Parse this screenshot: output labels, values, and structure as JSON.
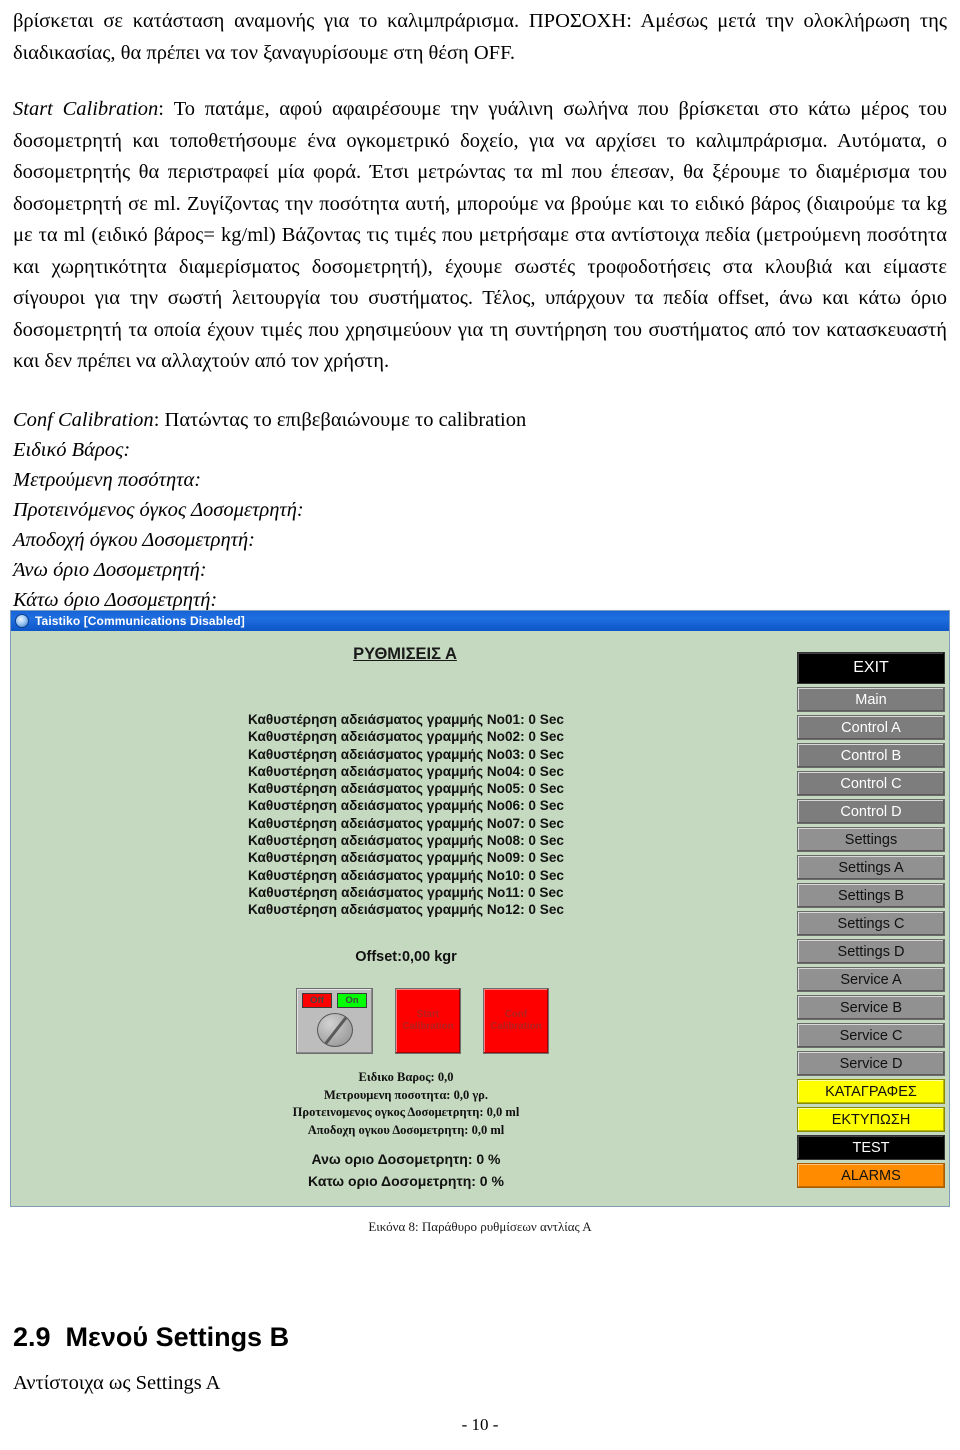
{
  "document": {
    "paragraph_1": "βρίσκεται σε κατάσταση αναμονής για το καλιμπράρισμα. ΠΡΟΣΟΧΗ: Αμέσως μετά την ολοκλήρωση της διαδικασίας, θα πρέπει να τον ξαναγυρίσουμε στη θέση OFF.",
    "paragraph_2_lead": "Start Calibration",
    "paragraph_2": ": Το πατάμε, αφού αφαιρέσουμε την γυάλινη σωλήνα που βρίσκεται στο κάτω μέρος του δοσομετρητή και τοποθετήσουμε ένα ογκομετρικό δοχείο, για να αρχίσει το καλιμπράρισμα. Αυτόματα, ο δοσομετρητής θα περιστραφεί μία φορά. Έτσι μετρώντας τα ml που έπεσαν, θα ξέρουμε το διαμέρισμα του δοσομετρητή σε ml. Ζυγίζοντας την ποσότητα αυτή, μπορούμε να βρούμε και το ειδικό βάρος (διαιρούμε τα kg με τα ml (ειδικό βάρος= kg/ml) Βάζοντας τις τιμές που μετρήσαμε στα αντίστοιχα πεδία (μετρούμενη ποσότητα και χωρητικότητα διαμερίσματος δοσομετρητή), έχουμε σωστές τροφοδοτήσεις στα κλουβιά και είμαστε σίγουροι για την σωστή λειτουργία του συστήματος. Τέλος, υπάρχουν τα πεδία offset, άνω και κάτω όριο δοσομετρητή τα οποία έχουν τιμές που χρησιμεύουν για τη συντήρηση του συστήματος από τον κατασκευαστή και δεν πρέπει να αλλαχτούν από τον χρήστη.",
    "field_list_lead": "Conf Calibration",
    "field_list_lead_rest": ": Πατώντας το επιβεβαιώνουμε το calibration",
    "field_list": [
      "Ειδικό Βάρος:",
      "Μετρούμενη ποσότητα:",
      "Προτεινόμενος όγκος Δοσομετρητή:",
      "Αποδοχή όγκου Δοσομετρητή:",
      "Άνω όριο Δοσομετρητή:",
      "Κάτω όριο Δοσομετρητή:"
    ],
    "figure_caption": "Εικόνα 8: Παράθυρο ρυθμίσεων αντλίας Α",
    "section_heading": "2.9  Μενού Settings B",
    "section_subtext": "Αντίστοιχα ως Settings A",
    "page_number": "- 10 -"
  },
  "app": {
    "window_title": "Taistiko [Communications Disabled]",
    "screen_title": "ΡΥΘΜΙΣΕΙΣ Α",
    "delay_lines": [
      "Καθυστέρηση αδειάσματος γραμμής No01: 0 Sec",
      "Καθυστέρηση αδειάσματος γραμμής No02: 0 Sec",
      "Καθυστέρηση αδειάσματος γραμμής No03: 0 Sec",
      "Καθυστέρηση αδειάσματος γραμμής No04: 0 Sec",
      "Καθυστέρηση αδειάσματος γραμμής No05: 0 Sec",
      "Καθυστέρηση αδειάσματος γραμμής No06: 0 Sec",
      "Καθυστέρηση αδειάσματος γραμμής No07: 0 Sec",
      "Καθυστέρηση αδειάσματος γραμμής No08: 0 Sec",
      "Καθυστέρηση αδειάσματος γραμμής No09: 0 Sec",
      "Καθυστέρηση αδειάσματος γραμμής No10: 0 Sec",
      "Καθυστέρηση αδειάσματος γραμμής No11: 0 Sec",
      "Καθυστέρηση αδειάσματος γραμμής No12: 0 Sec"
    ],
    "offset_label": "Offset:0,00 kgr",
    "switch": {
      "off_label": "Off",
      "on_label": "On"
    },
    "buttons": {
      "start_calibration_line1": "Start",
      "start_calibration_line2": "Calibration",
      "conf_calibration_line1": "Conf",
      "conf_calibration_line2": "Calibration"
    },
    "values": [
      "Ειδικο Βαρος: 0,0",
      "Μετρουμενη ποσοτητα: 0,0 γρ.",
      "Προτεινομενος ογκος Δοσομετρητη: 0,0 ml",
      "Αποδοχη ογκου Δοσομετρητη: 0,0 ml"
    ],
    "limits": [
      "Ανω οριο Δοσομετρητη: 0 %",
      "Κατω οριο Δοσομετρητη: 0 %"
    ],
    "nav_buttons": [
      {
        "label": "EXIT",
        "style": "exit"
      },
      {
        "label": "Main",
        "style": "dark-grey"
      },
      {
        "label": "Control A",
        "style": "dark-grey"
      },
      {
        "label": "Control B",
        "style": "dark-grey"
      },
      {
        "label": "Control C",
        "style": "dark-grey"
      },
      {
        "label": "Control D",
        "style": "dark-grey"
      },
      {
        "label": "Settings",
        "style": "mid-grey"
      },
      {
        "label": "Settings A",
        "style": "mid-grey"
      },
      {
        "label": "Settings B",
        "style": "mid-grey"
      },
      {
        "label": "Settings C",
        "style": "mid-grey"
      },
      {
        "label": "Settings D",
        "style": "mid-grey"
      },
      {
        "label": "Service A",
        "style": "mid-grey"
      },
      {
        "label": "Service B",
        "style": "mid-grey"
      },
      {
        "label": "Service C",
        "style": "mid-grey"
      },
      {
        "label": "Service D",
        "style": "mid-grey"
      },
      {
        "label": "ΚΑΤΑΓΡΑΦΕΣ",
        "style": "yellow"
      },
      {
        "label": "ΕΚΤΥΠΩΣΗ",
        "style": "yellow"
      },
      {
        "label": "TEST",
        "style": "black"
      },
      {
        "label": "ALARMS",
        "style": "orange"
      }
    ]
  },
  "colors": {
    "app_background": "#c5d9c0",
    "titlebar": "#1663d8",
    "alarm": "#ff8c00",
    "record": "#ffff00",
    "calibration_button": "#ff0000",
    "switch_off": "#ff0000",
    "switch_on": "#00ff00"
  }
}
